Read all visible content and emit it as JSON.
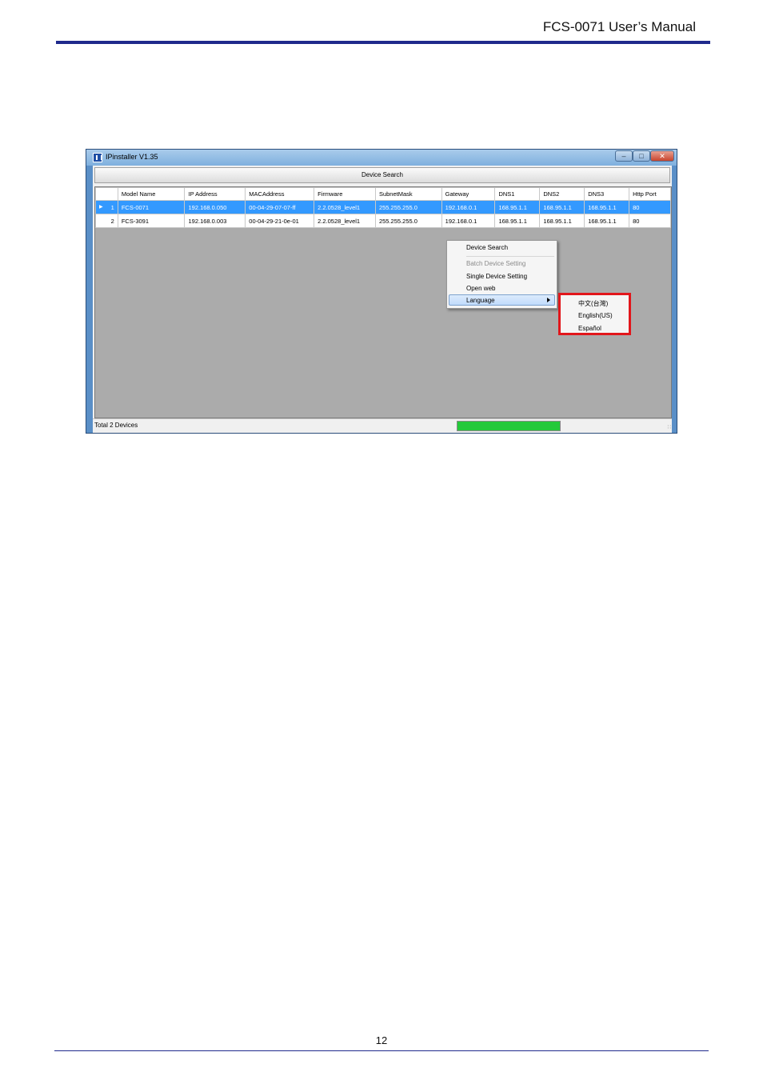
{
  "header": {
    "title": "FCS-0071 User’s Manual"
  },
  "window": {
    "title": "IPinstaller V1.35",
    "search_button": "Device Search",
    "columns": [
      "",
      "Model Name",
      "IP Address",
      "MACAddress",
      "Firmware",
      "SubnetMask",
      "Gateway",
      "DNS1",
      "DNS2",
      "DNS3",
      "Http Port"
    ],
    "rows": [
      {
        "index": "1",
        "selected": true,
        "cells": [
          "FCS-0071",
          "192.168.0.050",
          "00-04-29-07-07-ff",
          "2.2.0528_level1",
          "255.255.255.0",
          "192.168.0.1",
          "168.95.1.1",
          "168.95.1.1",
          "168.95.1.1",
          "80"
        ]
      },
      {
        "index": "2",
        "selected": false,
        "cells": [
          "FCS-3091",
          "192.168.0.003",
          "00-04-29-21-0e-01",
          "2.2.0528_level1",
          "255.255.255.0",
          "192.168.0.1",
          "168.95.1.1",
          "168.95.1.1",
          "168.95.1.1",
          "80"
        ]
      }
    ],
    "context_menu": {
      "device_search": "Device Search",
      "batch_device_setting": "Batch Device Setting",
      "single_device_setting": "Single Device Setting",
      "open_web": "Open web",
      "language": "Language"
    },
    "language_submenu": [
      "中文(台灣)",
      "English(US)",
      "Español"
    ],
    "status": "Total 2 Devices",
    "progress": 1.0
  },
  "footer": {
    "page_number": "12"
  }
}
